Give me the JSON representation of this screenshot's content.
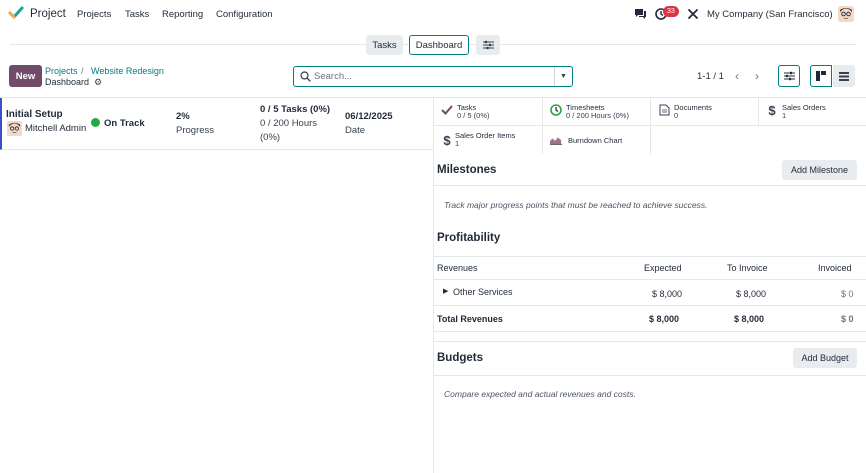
{
  "navbar": {
    "app_name": "Project",
    "menu": [
      "Projects",
      "Tasks",
      "Reporting",
      "Configuration"
    ],
    "notification_count": "33",
    "company": "My Company (San Francisco)"
  },
  "view_switcher": {
    "tasks_label": "Tasks",
    "dashboard_label": "Dashboard"
  },
  "control_panel": {
    "new_label": "New",
    "breadcrumb": [
      "Projects",
      "Website Redesign"
    ],
    "current": "Dashboard",
    "search_placeholder": "Search...",
    "pager": "1-1 / 1"
  },
  "project": {
    "name": "Initial Setup",
    "user": "Mitchell Admin",
    "status": "On Track",
    "status_color": "#28a745",
    "progress_value": "2%",
    "progress_label": "Progress",
    "tasks_summary": "0 / 5 Tasks (0%)",
    "hours_summary": "0 / 200 Hours",
    "hours_pct": "(0%)",
    "date_value": "06/12/2025",
    "date_label": "Date"
  },
  "stat_buttons": [
    {
      "title": "Tasks",
      "value": "0 / 5 (0%)",
      "icon": "check-icon"
    },
    {
      "title": "Timesheets",
      "value": "0 / 200 Hours (0%)",
      "icon": "clock-icon"
    },
    {
      "title": "Documents",
      "value": "0",
      "icon": "document-icon"
    },
    {
      "title": "Sales Orders",
      "value": "1",
      "icon": "dollar-icon"
    },
    {
      "title": "Sales Order Items",
      "value": "1",
      "icon": "dollar-icon"
    },
    {
      "title": "Burndown Chart",
      "value": "",
      "icon": "area-chart-icon"
    }
  ],
  "milestones": {
    "title": "Milestones",
    "button": "Add Milestone",
    "hint": "Track major progress points that must be reached to achieve success."
  },
  "profitability": {
    "title": "Profitability",
    "columns": [
      "Revenues",
      "Expected",
      "To Invoice",
      "Invoiced"
    ],
    "rows": [
      {
        "label": "Other Services",
        "expected": "$ 8,000",
        "to_invoice": "$ 8,000",
        "invoiced": "$ 0"
      }
    ],
    "total": {
      "label": "Total Revenues",
      "expected": "$ 8,000",
      "to_invoice": "$ 8,000",
      "invoiced": "$ 0"
    }
  },
  "budgets": {
    "title": "Budgets",
    "button": "Add Budget",
    "hint": "Compare expected and actual revenues and costs."
  },
  "colors": {
    "brand": "#714b67",
    "accent": "#017e84",
    "badge": "#dc3545"
  }
}
